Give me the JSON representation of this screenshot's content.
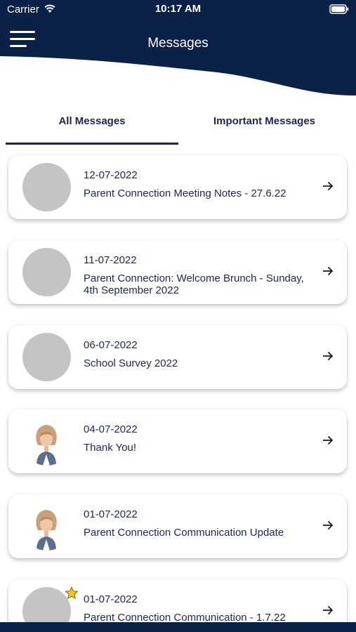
{
  "status_bar": {
    "carrier": "Carrier",
    "time": "10:17 AM"
  },
  "header": {
    "title": "Messages",
    "background_color": "#0b2147"
  },
  "tabs": [
    {
      "label": "All Messages",
      "selected": true
    },
    {
      "label": "Important Messages",
      "selected": false
    }
  ],
  "messages": [
    {
      "date": "12-07-2022",
      "subject": "Parent Connection Meeting Notes - 27.6.22",
      "avatar": "placeholder",
      "starred": false
    },
    {
      "date": "11-07-2022",
      "subject": "Parent Connection: Welcome Brunch - Sunday, 4th September 2022",
      "avatar": "placeholder",
      "starred": false
    },
    {
      "date": "06-07-2022",
      "subject": "School Survey 2022",
      "avatar": "placeholder",
      "starred": false
    },
    {
      "date": "04-07-2022",
      "subject": "Thank You!",
      "avatar": "photo",
      "starred": false
    },
    {
      "date": "01-07-2022",
      "subject": "Parent Connection Communication Update",
      "avatar": "photo",
      "starred": false
    },
    {
      "date": "01-07-2022",
      "subject": "Parent Connection Communication - 1.7.22",
      "avatar": "placeholder",
      "starred": true
    }
  ],
  "icons": {
    "menu": "hamburger-menu-icon",
    "arrow": "arrow-right-icon",
    "star": "star-icon",
    "wifi": "wifi-icon",
    "battery": "battery-icon"
  },
  "colors": {
    "navy": "#0b2147",
    "text": "#1f2550",
    "placeholder_avatar": "#c4c4c4",
    "star": "#f5c518"
  }
}
